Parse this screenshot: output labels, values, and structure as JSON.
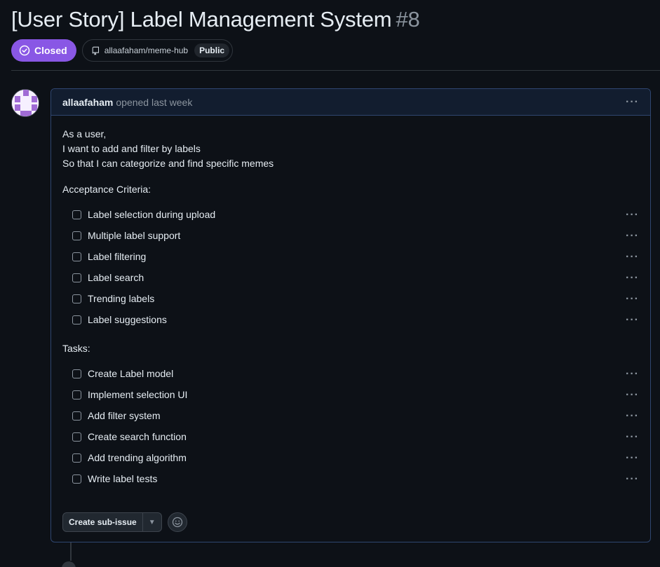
{
  "issue": {
    "title": "[User Story] Label Management System",
    "number": "#8",
    "state": "Closed",
    "state_color": "#8957e5",
    "repo": "allaafaham/meme-hub",
    "visibility": "Public"
  },
  "comment": {
    "author": "allaafaham",
    "opened_text": "opened last week",
    "menu_icon": "kebab-horizontal-icon",
    "intro_lines": [
      "As a user,",
      "I want to add and filter by labels",
      "So that I can categorize and find specific memes"
    ],
    "acceptance_label": "Acceptance Criteria:",
    "acceptance_items": [
      "Label selection during upload",
      "Multiple label support",
      "Label filtering",
      "Label search",
      "Trending labels",
      "Label suggestions"
    ],
    "tasks_label": "Tasks:",
    "task_items": [
      "Create Label model",
      "Implement selection UI",
      "Add filter system",
      "Create search function",
      "Add trending algorithm",
      "Write label tests"
    ],
    "create_subissue_label": "Create sub-issue",
    "reaction_icon": "smiley-icon"
  }
}
